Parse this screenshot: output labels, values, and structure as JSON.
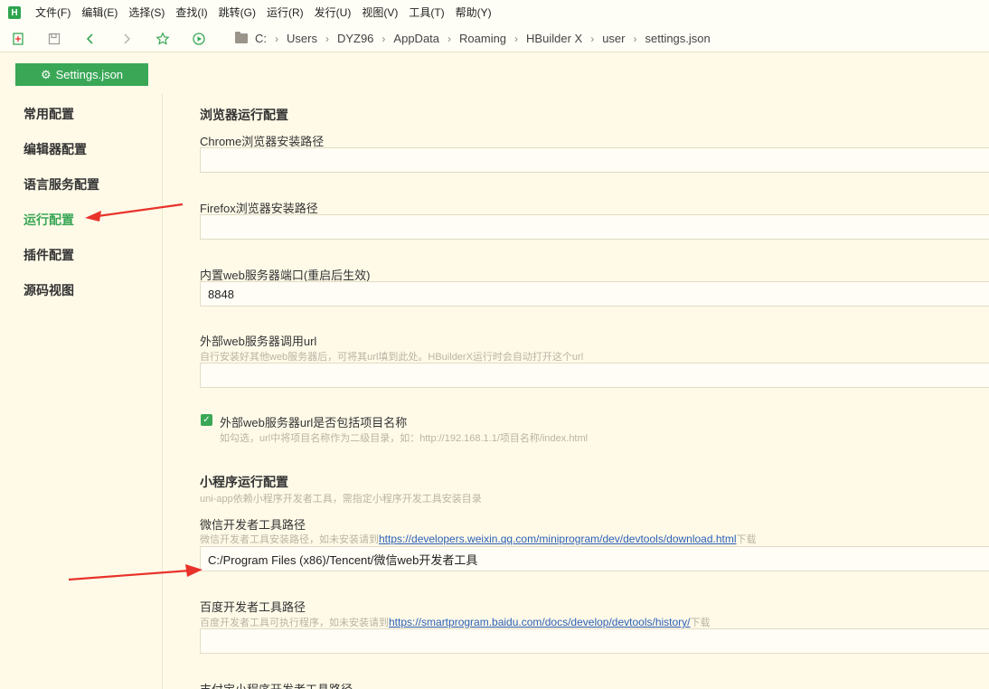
{
  "menubar": {
    "logo": "H",
    "items": [
      "文件(F)",
      "编辑(E)",
      "选择(S)",
      "查找(I)",
      "跳转(G)",
      "运行(R)",
      "发行(U)",
      "视图(V)",
      "工具(T)",
      "帮助(Y)"
    ]
  },
  "toolbar": {
    "icons": [
      "new-file-icon",
      "save-icon",
      "back-icon",
      "forward-icon",
      "star-icon",
      "run-icon"
    ],
    "breadcrumb": [
      "C:",
      "Users",
      "DYZ96",
      "AppData",
      "Roaming",
      "HBuilder X",
      "user",
      "settings.json"
    ]
  },
  "tab": {
    "label": "Settings.json"
  },
  "sidebar": {
    "items": [
      "常用配置",
      "编辑器配置",
      "语言服务配置",
      "运行配置",
      "插件配置",
      "源码视图"
    ],
    "active_index": 3
  },
  "content": {
    "browser_section": "浏览器运行配置",
    "chrome_label": "Chrome浏览器安装路径",
    "chrome_value": "",
    "firefox_label": "Firefox浏览器安装路径",
    "firefox_value": "",
    "port_label": "内置web服务器端口(重启后生效)",
    "port_value": "8848",
    "ext_url_label": "外部web服务器调用url",
    "ext_url_hint": "自行安装好其他web服务器后，可将其url填到此处。HBuilderX运行时会自动打开这个url",
    "ext_url_value": "",
    "include_name_label": "外部web服务器url是否包括项目名称",
    "include_name_hint": "如勾选，url中将项目名称作为二级目录，如：http://192.168.1.1/项目名称/index.html",
    "include_name_checked": true,
    "mini_section": "小程序运行配置",
    "mini_hint": "uni-app依赖小程序开发者工具，需指定小程序开发工具安装目录",
    "wechat_label": "微信开发者工具路径",
    "wechat_hint_pre": "微信开发者工具安装路径，如未安装请到",
    "wechat_link": "https://developers.weixin.qq.com/miniprogram/dev/devtools/download.html",
    "wechat_hint_post": "下载",
    "wechat_value": "C:/Program Files (x86)/Tencent/微信web开发者工具",
    "baidu_label": "百度开发者工具路径",
    "baidu_hint_pre": "百度开发者工具可执行程序，如未安装请到",
    "baidu_link": "https://smartprogram.baidu.com/docs/develop/devtools/history/",
    "baidu_hint_post": "下载",
    "baidu_value": "",
    "alipay_label": "支付宝小程序开发者工具路径"
  },
  "colors": {
    "accent": "#3aa757",
    "arrow": "#e8322a",
    "link": "#2b5fb8"
  }
}
